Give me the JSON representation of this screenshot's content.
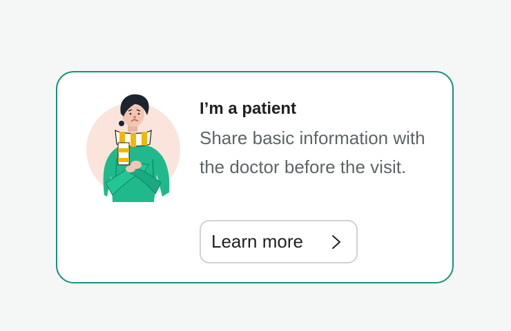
{
  "card": {
    "title": "I’m a patient",
    "description": "Share basic information with the doctor before the visit.",
    "button_label": "Learn more",
    "button_icon": "chevron-right-icon",
    "illustration": "sick-patient-illustration"
  },
  "colors": {
    "background": "#f5f7f6",
    "card_border": "#15917d",
    "title": "#202020",
    "description": "#5d6467",
    "button_border": "#cfd3d2",
    "sweater": "#1fb98c",
    "scarf": "#f2b705",
    "circle": "#fbe4dc"
  }
}
